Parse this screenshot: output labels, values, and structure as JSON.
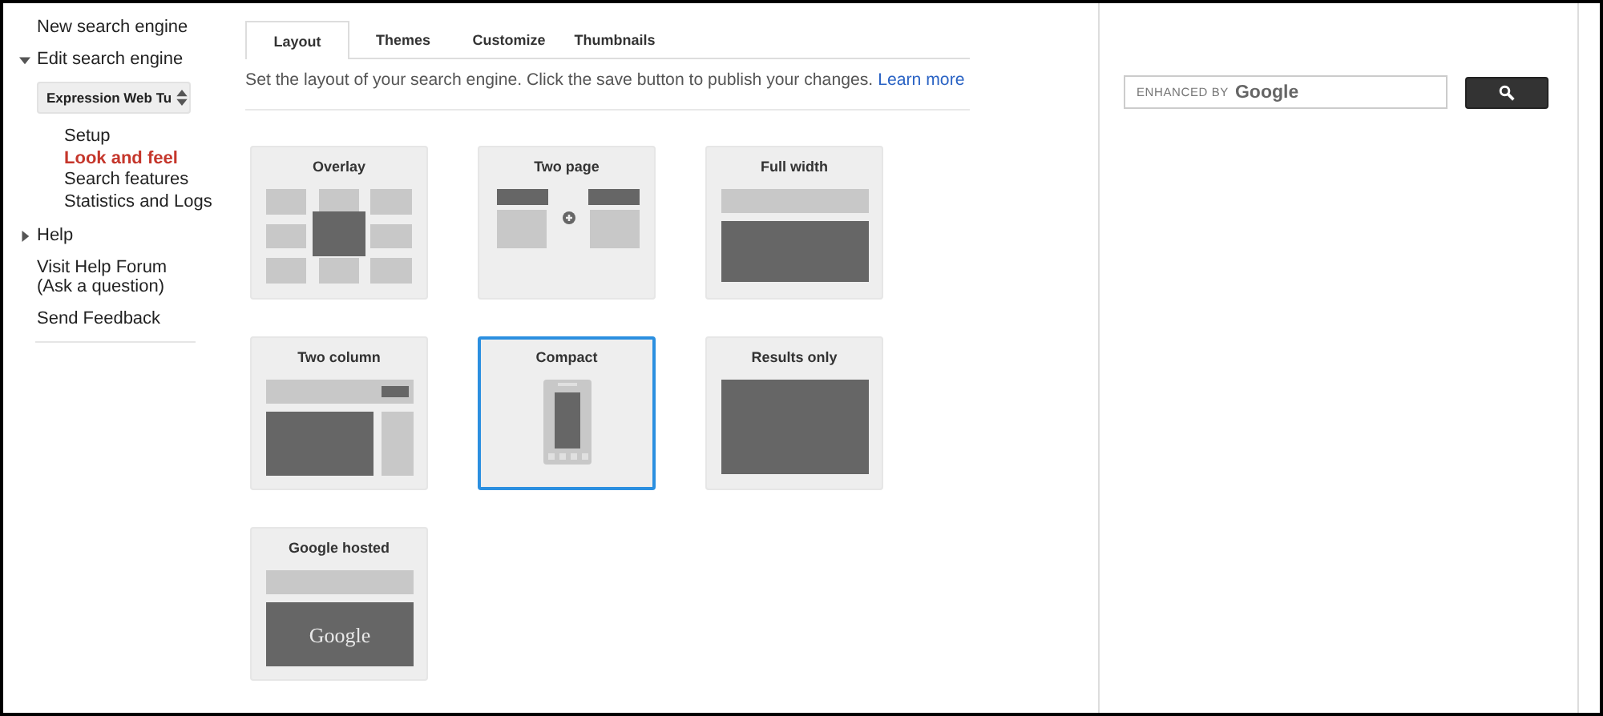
{
  "sidebar": [
    {
      "kind": "link",
      "label": "New search engine"
    },
    {
      "kind": "section",
      "label": "Edit search engine",
      "expanded": true,
      "select": "Expression Web Tu",
      "children": [
        {
          "label": "Setup",
          "selected": false
        },
        {
          "label": "Look and feel",
          "selected": true
        },
        {
          "label": "Search features",
          "selected": false
        },
        {
          "label": "Statistics and Logs",
          "selected": false
        }
      ]
    },
    {
      "kind": "section",
      "label": "Help",
      "expanded": false
    },
    {
      "kind": "link",
      "label": "Visit Help Forum (Ask a question)"
    },
    {
      "kind": "link",
      "label": "Send Feedback"
    }
  ],
  "tabs": [
    {
      "label": "Layout",
      "selected": true
    },
    {
      "label": "Themes",
      "selected": false
    },
    {
      "label": "Customize",
      "selected": false
    },
    {
      "label": "Thumbnails",
      "selected": false
    }
  ],
  "description": {
    "text": "Set the layout of your search engine. Click the save button to publish your changes.",
    "link": "Learn more"
  },
  "layouts": [
    {
      "title": "Overlay",
      "kind": "overlay",
      "selected": false
    },
    {
      "title": "Two page",
      "kind": "two_page",
      "selected": false
    },
    {
      "title": "Full width",
      "kind": "full_width",
      "selected": false
    },
    {
      "title": "Two column",
      "kind": "two_column",
      "selected": false
    },
    {
      "title": "Compact",
      "kind": "compact",
      "selected": true
    },
    {
      "title": "Results only",
      "kind": "results_only",
      "selected": false
    },
    {
      "title": "Google hosted",
      "kind": "google_hosted",
      "selected": false,
      "logo": "Google"
    }
  ],
  "preview": {
    "placeholder_prefix": "ENHANCED BY",
    "placeholder_brand": "Google"
  }
}
